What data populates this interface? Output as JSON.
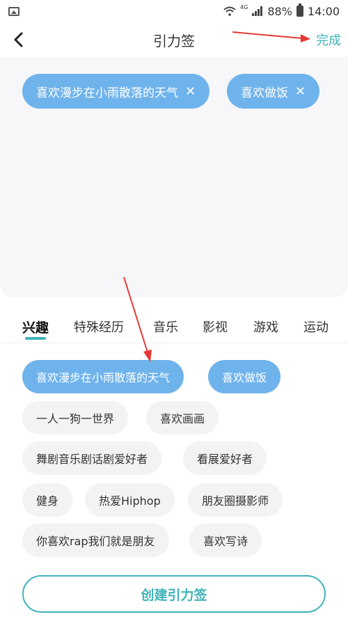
{
  "status_bar": {
    "battery": "88%",
    "time": "14:00",
    "network": "4G"
  },
  "nav": {
    "title": "引力签",
    "done_label": "完成"
  },
  "selected_tags": [
    {
      "label": "喜欢漫步在小雨散落的天气",
      "remove": "✕"
    },
    {
      "label": "喜欢做饭",
      "remove": "✕"
    }
  ],
  "tabs": [
    {
      "label": "兴趣",
      "active": true
    },
    {
      "label": "特殊经历"
    },
    {
      "label": "音乐"
    },
    {
      "label": "影视"
    },
    {
      "label": "游戏"
    },
    {
      "label": "运动"
    }
  ],
  "tags": [
    {
      "label": "喜欢漫步在小雨散落的天气",
      "selected": true
    },
    {
      "label": "喜欢做饭",
      "selected": true
    },
    {
      "label": "一人一狗一世界"
    },
    {
      "label": "喜欢画画"
    },
    {
      "label": "舞剧音乐剧话剧爱好者"
    },
    {
      "label": "看展爱好者"
    },
    {
      "label": "健身"
    },
    {
      "label": "热爱Hiphop"
    },
    {
      "label": "朋友圈摄影师"
    },
    {
      "label": "你喜欢rap我们就是朋友"
    },
    {
      "label": "喜欢写诗"
    }
  ],
  "create_button": "创建引力签",
  "colors": {
    "accent": "#3fb3b8",
    "tag_selected": "#6fb3ec",
    "annotation": "#e53935"
  },
  "icons": [
    "image-icon",
    "wifi-icon",
    "signal-icon",
    "battery-icon",
    "back-arrow-icon",
    "remove-icon"
  ]
}
